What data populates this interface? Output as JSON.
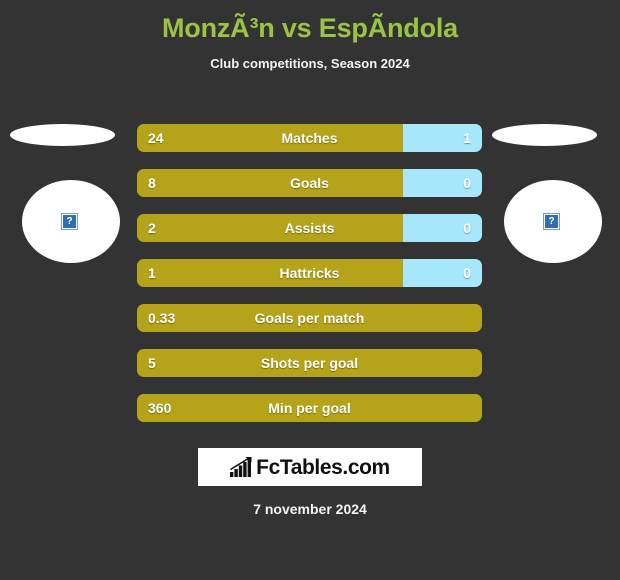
{
  "header": {
    "title": "MonzÃ³n vs EspÃ­ndola",
    "subtitle": "Club competitions, Season 2024"
  },
  "crests": {
    "home_alt": "broken-image",
    "away_alt": "broken-image",
    "placeholder_glyph": "?"
  },
  "stats": {
    "rows": [
      {
        "label": "Matches",
        "home": "24",
        "away": "1",
        "home_pct": 77,
        "away_pct": 23,
        "split": true
      },
      {
        "label": "Goals",
        "home": "8",
        "away": "0",
        "home_pct": 77,
        "away_pct": 23,
        "split": true
      },
      {
        "label": "Assists",
        "home": "2",
        "away": "0",
        "home_pct": 77,
        "away_pct": 23,
        "split": true
      },
      {
        "label": "Hattricks",
        "home": "1",
        "away": "0",
        "home_pct": 77,
        "away_pct": 23,
        "split": true
      },
      {
        "label": "Goals per match",
        "home": "0.33",
        "away": "",
        "home_pct": 100,
        "away_pct": 0,
        "split": false
      },
      {
        "label": "Shots per goal",
        "home": "5",
        "away": "",
        "home_pct": 100,
        "away_pct": 0,
        "split": false
      },
      {
        "label": "Min per goal",
        "home": "360",
        "away": "",
        "home_pct": 100,
        "away_pct": 0,
        "split": false
      }
    ]
  },
  "footer": {
    "logo_text": "FcTables.com",
    "logo_icon": "bar-chart-icon",
    "date": "7 november 2024"
  },
  "colors": {
    "background": "#333333",
    "title": "#9ac446",
    "home_bar": "#b5a31a",
    "away_bar": "#a6e7fb",
    "text": "#ffffff"
  },
  "chart_data": {
    "type": "bar",
    "title": "MonzÃ³n vs EspÃ­ndola",
    "subtitle": "Club competitions, Season 2024",
    "categories": [
      "Matches",
      "Goals",
      "Assists",
      "Hattricks",
      "Goals per match",
      "Shots per goal",
      "Min per goal"
    ],
    "series": [
      {
        "name": "MonzÃ³n",
        "values": [
          24,
          8,
          2,
          1,
          0.33,
          5,
          360
        ],
        "color": "#b5a31a"
      },
      {
        "name": "EspÃ­ndola",
        "values": [
          1,
          0,
          0,
          0,
          null,
          null,
          null
        ],
        "color": "#a6e7fb"
      }
    ],
    "orientation": "horizontal",
    "grid": false,
    "legend": "none",
    "annotation": "7 november 2024"
  }
}
